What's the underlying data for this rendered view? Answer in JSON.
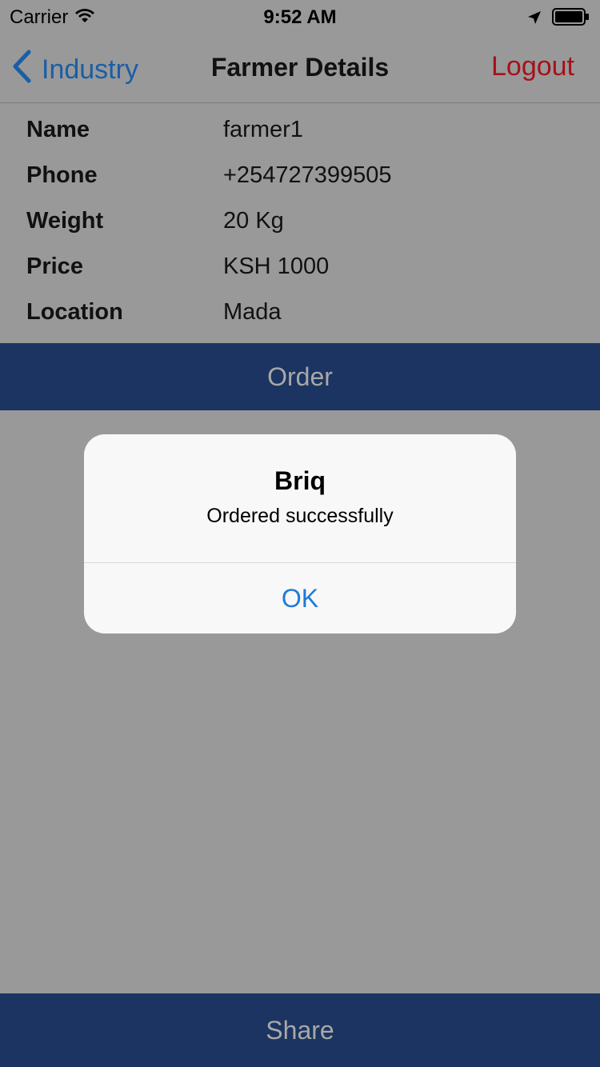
{
  "status_bar": {
    "carrier": "Carrier",
    "time": "9:52 AM",
    "icons": {
      "wifi": "wifi-icon",
      "location": "location-arrow-icon",
      "battery": "battery-icon"
    }
  },
  "nav": {
    "back_label": "Industry",
    "title": "Farmer Details",
    "logout_label": "Logout",
    "back_color": "#1a5ea6",
    "logout_color": "#a6111a"
  },
  "details": [
    {
      "label": "Name",
      "value": "farmer1"
    },
    {
      "label": "Phone",
      "value": "+254727399505"
    },
    {
      "label": "Weight",
      "value": "20 Kg"
    },
    {
      "label": "Price",
      "value": "KSH 1000"
    },
    {
      "label": "Location",
      "value": "Mada"
    }
  ],
  "order_button": {
    "label": "Order",
    "color": "#1b3461"
  },
  "alert": {
    "title": "Briq",
    "message": "Ordered successfully",
    "ok_label": "OK",
    "ok_color": "#1f7ad8"
  },
  "share_button": {
    "label": "Share",
    "color": "#1b3461"
  }
}
